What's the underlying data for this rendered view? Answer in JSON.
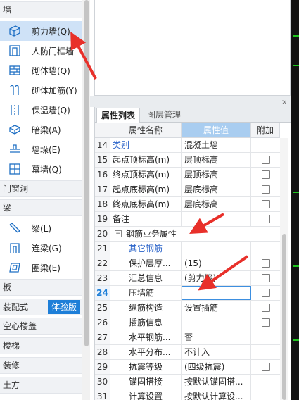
{
  "left_nav": {
    "sections": {
      "wall": "墙",
      "door_window": "门窗洞",
      "beam": "梁",
      "slab": "板",
      "prefab": "装配式",
      "hollow_slab": "空心楼盖",
      "stair": "楼梯",
      "decoration": "装修",
      "earthwork": "土方"
    },
    "wall_items": [
      {
        "label": "剪力墙(Q)",
        "icon": "shear-wall-icon"
      },
      {
        "label": "人防门框墙",
        "icon": "civil-defense-door-wall-icon"
      },
      {
        "label": "砌体墙(Q)",
        "icon": "masonry-wall-icon"
      },
      {
        "label": "砌体加筋(Y)",
        "icon": "masonry-reinforcement-icon"
      },
      {
        "label": "保温墙(Q)",
        "icon": "insulation-wall-icon"
      },
      {
        "label": "暗梁(A)",
        "icon": "hidden-beam-icon"
      },
      {
        "label": "墙垛(E)",
        "icon": "wall-pier-icon"
      },
      {
        "label": "幕墙(Q)",
        "icon": "curtain-wall-icon"
      }
    ],
    "beam_items": [
      {
        "label": "梁(L)",
        "icon": "beam-icon"
      },
      {
        "label": "连梁(G)",
        "icon": "coupling-beam-icon"
      },
      {
        "label": "圈梁(E)",
        "icon": "ring-beam-icon"
      }
    ],
    "trial_button": "体验版"
  },
  "prop_panel": {
    "tabs": [
      "属性列表",
      "图层管理"
    ],
    "columns": {
      "name": "属性名称",
      "value": "属性值",
      "extra": "附加"
    },
    "rows": [
      {
        "num": "14",
        "name": "类别",
        "value": "混凝土墙",
        "checkbox": false
      },
      {
        "num": "15",
        "name": "起点顶标高(m)",
        "value": "层顶标高",
        "checkbox": true
      },
      {
        "num": "16",
        "name": "终点顶标高(m)",
        "value": "层顶标高",
        "checkbox": true
      },
      {
        "num": "17",
        "name": "起点底标高(m)",
        "value": "层底标高",
        "checkbox": true
      },
      {
        "num": "18",
        "name": "终点底标高(m)",
        "value": "层底标高",
        "checkbox": true
      },
      {
        "num": "19",
        "name": "备注",
        "value": "",
        "checkbox": true
      },
      {
        "num": "20",
        "name": "钢筋业务属性",
        "value": "",
        "checkbox": false
      },
      {
        "num": "21",
        "name": "其它钢筋",
        "value": "",
        "checkbox": false
      },
      {
        "num": "22",
        "name": "保护层厚...",
        "value": "(15)",
        "checkbox": true
      },
      {
        "num": "23",
        "name": "汇总信息",
        "value": "(剪力墙)",
        "checkbox": true
      },
      {
        "num": "24",
        "name": "压墙筋",
        "value": "",
        "checkbox": true
      },
      {
        "num": "25",
        "name": "纵筋构造",
        "value": "设置插筋",
        "checkbox": true
      },
      {
        "num": "26",
        "name": "插筋信息",
        "value": "",
        "checkbox": true
      },
      {
        "num": "27",
        "name": "水平钢筋...",
        "value": "否",
        "checkbox": false
      },
      {
        "num": "28",
        "name": "水平分布...",
        "value": "不计入",
        "checkbox": false
      },
      {
        "num": "29",
        "name": "抗震等级",
        "value": "(四级抗震)",
        "checkbox": true
      },
      {
        "num": "30",
        "name": "锚固搭接",
        "value": "按默认锚固搭...",
        "checkbox": false
      },
      {
        "num": "31",
        "name": "计算设置",
        "value": "按默认计算设...",
        "checkbox": false
      }
    ]
  },
  "panel_close": "×",
  "colors": {
    "accent_blue": "#1e7fd8",
    "selected_bg": "#cfe2f7",
    "header_value_bg": "#a9cdf0",
    "annotation_red": "#e8302a"
  }
}
